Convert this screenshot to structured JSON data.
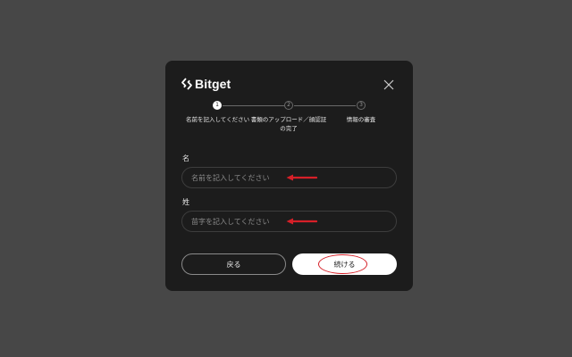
{
  "brand": {
    "name": "Bitget",
    "logo_icon": "bitget-logo-icon"
  },
  "stepper": {
    "steps": [
      {
        "number": "1",
        "label": "名前を記入してください",
        "state": "active"
      },
      {
        "number": "2",
        "label_line1": "書類のアップロード／顔認証",
        "label_line2": "の完了",
        "state": "inactive"
      },
      {
        "number": "3",
        "label": "情報の審査",
        "state": "inactive"
      }
    ]
  },
  "form": {
    "first_name": {
      "label": "名",
      "placeholder": "名前を記入してください",
      "value": ""
    },
    "last_name": {
      "label": "姓",
      "placeholder": "苗字を記入してください",
      "value": ""
    }
  },
  "buttons": {
    "back_label": "戻る",
    "continue_label": "続ける"
  },
  "colors": {
    "backdrop": "#474747",
    "modal_bg": "#1c1c1c",
    "annotation_red": "#d62028",
    "primary_button": "#ffffff"
  }
}
